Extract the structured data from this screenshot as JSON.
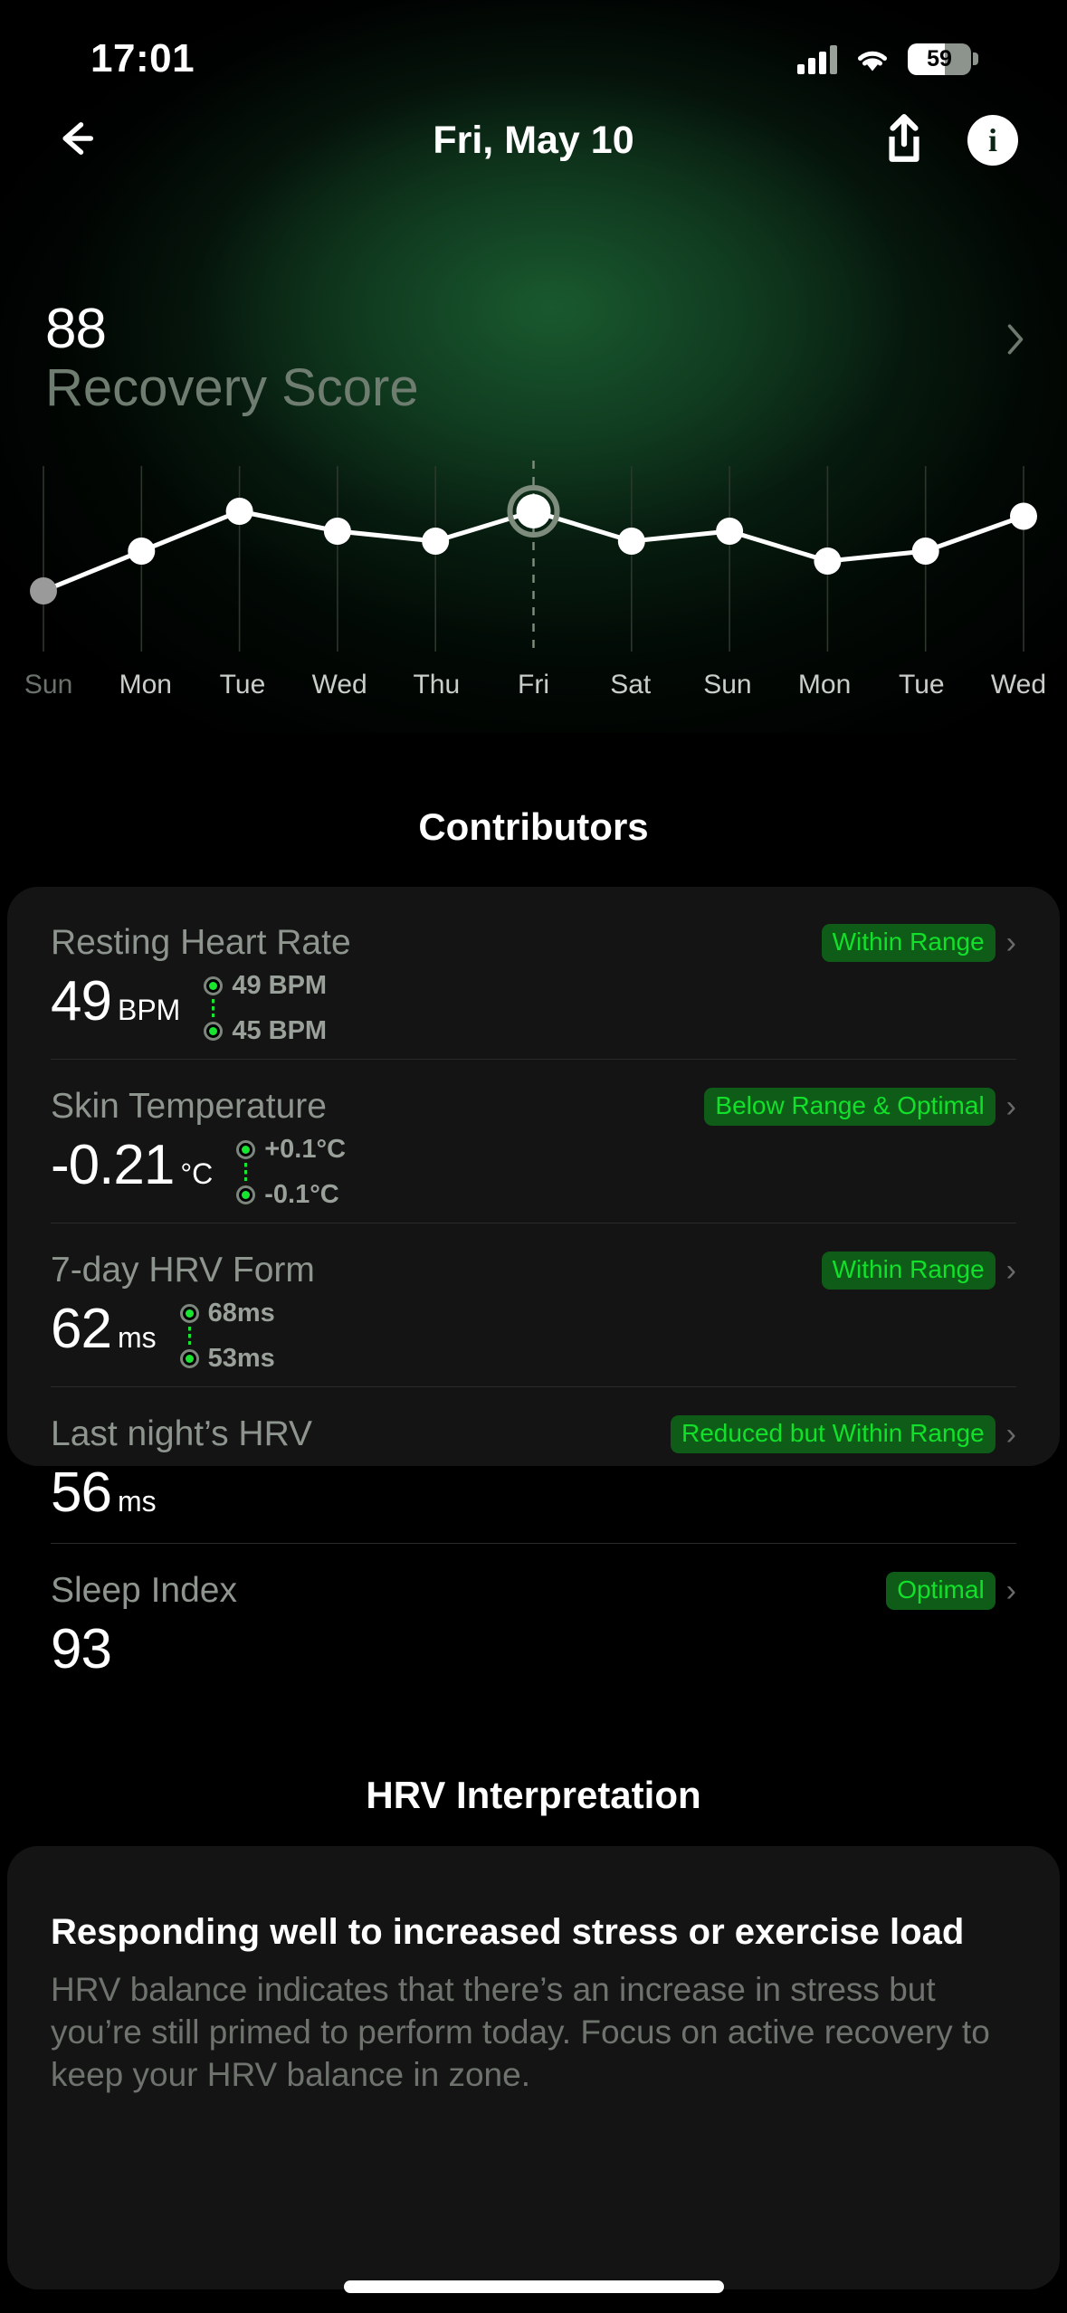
{
  "status_bar": {
    "time": "17:01",
    "battery_percent": "59",
    "signal_icon": "cellular-bars-icon",
    "wifi_icon": "wifi-icon",
    "battery_icon": "battery-icon"
  },
  "nav": {
    "back_icon": "back-arrow-icon",
    "title": "Fri, May 10",
    "share_icon": "share-icon",
    "info_icon": "info-icon",
    "info_glyph": "i"
  },
  "score": {
    "value": "88",
    "label": "Recovery Score",
    "chevron": "›"
  },
  "chart_data": {
    "type": "line",
    "title": "Recovery Score",
    "categories": [
      "Sun",
      "Mon",
      "Tue",
      "Wed",
      "Thu",
      "Fri",
      "Sat",
      "Sun",
      "Mon",
      "Tue",
      "Wed"
    ],
    "values": [
      72,
      80,
      88,
      84,
      82,
      88,
      82,
      84,
      78,
      80,
      87
    ],
    "selected_index": 5,
    "selected_label": "Fri",
    "dimmed_index": 0,
    "xlabel": "",
    "ylabel": "",
    "grid": true,
    "legend": "none",
    "line_color": "#ffffff",
    "point_color": "#ffffff",
    "dimmed_point_color": "#9a9a9a",
    "selected_ring_color": "#7d8c7d"
  },
  "contributors": {
    "title": "Contributors",
    "rows": [
      {
        "name": "Resting Heart Rate",
        "badge": "Within Range",
        "value": "49",
        "unit": "BPM",
        "range_high": "49 BPM",
        "range_low": "45 BPM",
        "has_range": true,
        "chevron": "›"
      },
      {
        "name": "Skin Temperature",
        "badge": "Below Range & Optimal",
        "value": "-0.21",
        "unit": "°C",
        "range_high": "+0.1°C",
        "range_low": "-0.1°C",
        "has_range": true,
        "chevron": "›"
      },
      {
        "name": "7-day HRV Form",
        "badge": "Within Range",
        "value": "62",
        "unit": "ms",
        "range_high": "68ms",
        "range_low": "53ms",
        "has_range": true,
        "chevron": "›"
      },
      {
        "name": "Last night’s HRV",
        "badge": "Reduced but Within Range",
        "value": "56",
        "unit": "ms",
        "range_high": "",
        "range_low": "",
        "has_range": false,
        "chevron": "›"
      },
      {
        "name": "Sleep Index",
        "badge": "Optimal",
        "value": "93",
        "unit": "",
        "range_high": "",
        "range_low": "",
        "has_range": false,
        "chevron": "›"
      }
    ]
  },
  "hrv_interpretation": {
    "title": "HRV Interpretation",
    "headline": "Responding well to increased stress or exercise load",
    "body": "HRV balance indicates that there’s an increase in stress but you’re still primed to perform today. Focus on active recovery to keep your HRV balance in zone."
  },
  "colors": {
    "badge_bg": "#0e5c18",
    "badge_text": "#12e02a",
    "accent_green": "#18e52f",
    "card_bg": "#141414",
    "muted_text": "#8e948e"
  }
}
